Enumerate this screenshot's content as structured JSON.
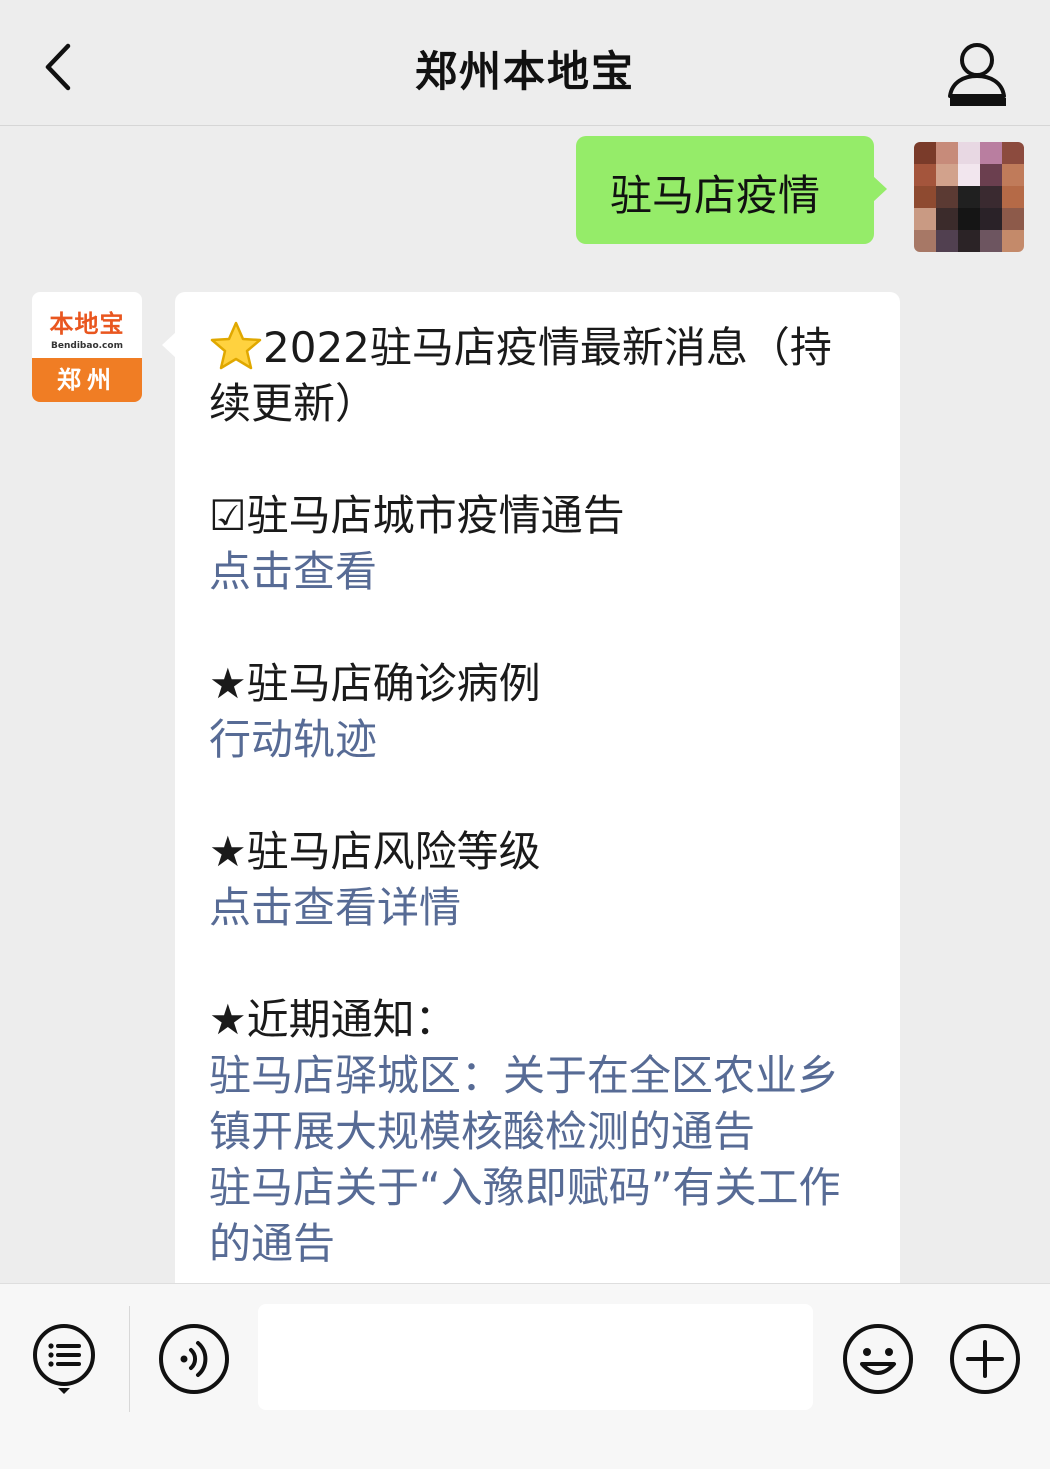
{
  "header": {
    "title": "郑州本地宝"
  },
  "outgoing_message": {
    "text": "驻马店疫情"
  },
  "bot_avatar": {
    "logo_text": "本地宝",
    "logo_sub": "Bendibao.com",
    "city": "郑州"
  },
  "incoming_message": {
    "headline": "2022驻马店疫情最新消息（持续更新）",
    "sections": [
      {
        "title": "☑驻马店城市疫情通告",
        "link": "点击查看"
      },
      {
        "title": "★驻马店确诊病例",
        "link": "行动轨迹"
      },
      {
        "title": "★驻马店风险等级",
        "link": "点击查看详情"
      }
    ],
    "recent": {
      "title": "★近期通知：",
      "links": [
        "驻马店驿城区：关于在全区农业乡镇开展大规模核酸检测的通告",
        "驻马店关于“入豫即赋码”有关工作的通告"
      ]
    }
  },
  "bottom_bar": {
    "input_value": "",
    "icons": [
      "menu-list-icon",
      "voice-icon",
      "emoji-icon",
      "plus-icon"
    ]
  },
  "colors": {
    "background": "#ededed",
    "outgoing_bubble": "#95ec69",
    "incoming_bubble": "#ffffff",
    "link": "#576b95",
    "brand_orange": "#f07d24"
  }
}
